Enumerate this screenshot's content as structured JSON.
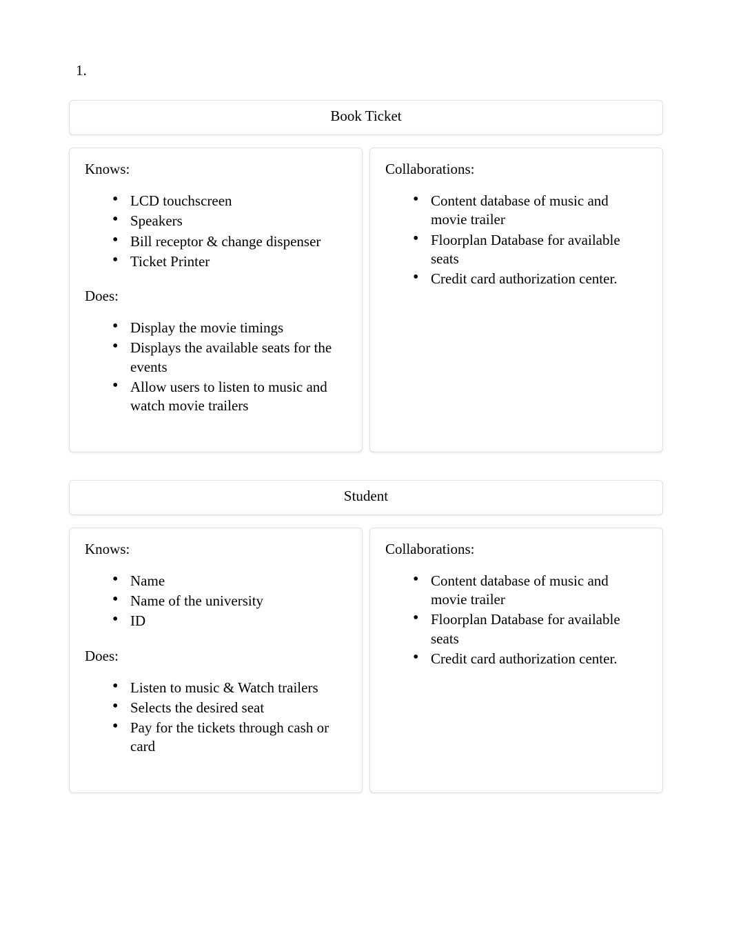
{
  "listNumber": "1.",
  "labels": {
    "knows": "Knows:",
    "does": "Does:",
    "collaborations": "Collaborations:"
  },
  "cards": [
    {
      "title": "Book Ticket",
      "knows": [
        "LCD touchscreen",
        "Speakers",
        "Bill receptor & change dispenser",
        "Ticket Printer"
      ],
      "does": [
        "Display the movie timings",
        "Displays the available seats for the events",
        "Allow users to listen to music and watch movie trailers"
      ],
      "collaborations": [
        "Content database of music and movie trailer",
        "Floorplan Database for available seats",
        "Credit card authorization center."
      ]
    },
    {
      "title": "Student",
      "knows": [
        "Name",
        "Name of the university",
        "ID"
      ],
      "does": [
        "Listen to music & Watch trailers",
        "Selects the desired seat",
        "Pay for the tickets through cash or card"
      ],
      "collaborations": [
        "Content database of music and movie trailer",
        "Floorplan Database for available seats",
        "Credit card authorization center."
      ]
    }
  ]
}
